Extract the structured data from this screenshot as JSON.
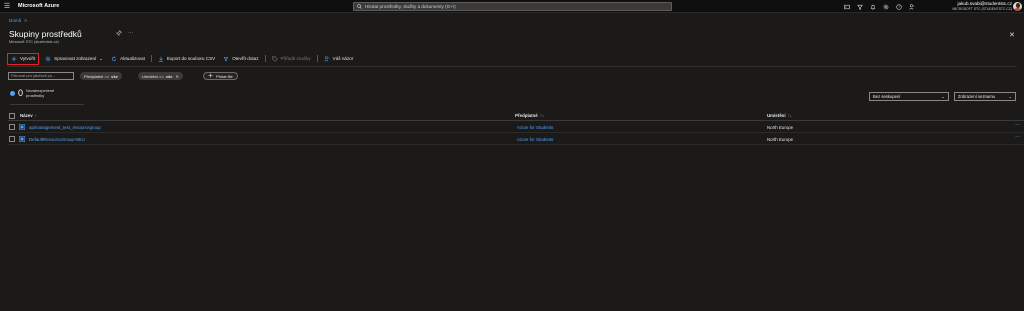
{
  "topbar": {
    "brand": "Microsoft Azure",
    "search_placeholder": "Hledat prostředky, služby a dokumenty (G+/)",
    "account_email": "jakub.svabi@studentstc.cz",
    "account_tenant": "MICROSOFT STC (STUDENTSTC.CZ)"
  },
  "breadcrumb": {
    "home": "Domů",
    "sep": ">"
  },
  "header": {
    "title": "Skupiny prostředků",
    "subtitle": "Microsoft STC (studentstc.cz)",
    "more": "···",
    "close": "✕"
  },
  "toolbar": {
    "create": "Vytvořit",
    "manage_view": "Spravovat zobrazení",
    "refresh": "Aktualizovat",
    "export": "Export do souboru CSV",
    "open_query": "Otevřít dotaz",
    "assign_tags": "Přiřadit značky",
    "feedback": "Váš názor"
  },
  "filters": {
    "filter_placeholder": "Filtrovat pro jakékoli po...",
    "subscription_label": "Předplatné == ",
    "subscription_value": "vše",
    "location_label": "Umístění == ",
    "location_value": "vše",
    "location_clear": "✕",
    "add_filter": "Přidat filtr"
  },
  "summary": {
    "count": "0",
    "label": "Nezabezpečené prostředky"
  },
  "view_controls": {
    "grouping": "Bez seskupení",
    "view": "Zobrazení seznamu"
  },
  "table": {
    "columns": {
      "name": "Název",
      "name_sort": "↑",
      "subscription": "Předplatné",
      "subscription_sort": "↑↓",
      "location": "Umístění",
      "location_sort": "↑↓"
    },
    "rows": [
      {
        "name": "apimanagement_test_resourcegroup",
        "subscription": "Azure for Students",
        "location": "North Europe",
        "more": "···"
      },
      {
        "name": "DefaultResourceGroup-NEU",
        "subscription": "Azure for Students",
        "location": "North Europe",
        "more": "···"
      }
    ]
  },
  "colors": {
    "accent": "#4fa3f7",
    "highlight": "#e3202c",
    "background": "#1b1a19"
  }
}
